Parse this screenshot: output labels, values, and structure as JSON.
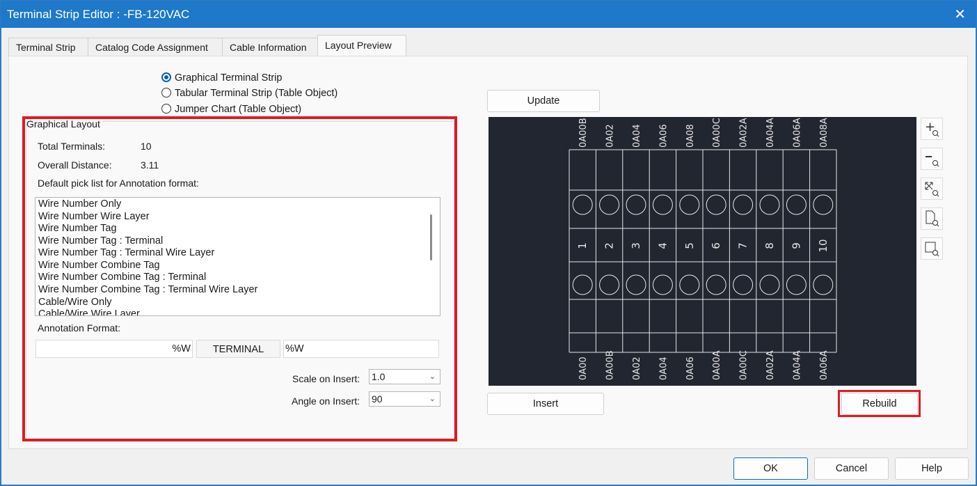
{
  "window": {
    "title": "Terminal Strip Editor : -FB-120VAC",
    "close_glyph": "✕"
  },
  "tabs": [
    {
      "label": "Terminal Strip"
    },
    {
      "label": "Catalog Code Assignment"
    },
    {
      "label": "Cable Information"
    },
    {
      "label": "Layout Preview"
    }
  ],
  "radios": [
    {
      "label": "Graphical Terminal Strip",
      "selected": true
    },
    {
      "label": "Tabular Terminal Strip (Table Object)",
      "selected": false
    },
    {
      "label": "Jumper Chart (Table Object)",
      "selected": false
    }
  ],
  "graphical_layout": {
    "group_label": "Graphical Layout",
    "total_terminals_label": "Total Terminals:",
    "total_terminals_value": "10",
    "overall_distance_label": "Overall Distance:",
    "overall_distance_value": "3.11",
    "picklist_label": "Default pick list for Annotation format:",
    "picklist_items": [
      "Wire Number Only",
      "Wire Number Wire Layer",
      "Wire Number Tag",
      "Wire Number Tag : Terminal",
      "Wire Number Tag : Terminal Wire Layer",
      "Wire Number Combine Tag",
      "Wire Number Combine Tag : Terminal",
      "Wire Number Combine Tag : Terminal Wire Layer",
      "Cable/Wire Only",
      "Cable/Wire Wire Layer"
    ],
    "annotation_format_label": "Annotation Format:",
    "annotation_left": "%W",
    "annotation_middle": "TERMINAL",
    "annotation_right": "%W",
    "scale_label": "Scale on Insert:",
    "scale_value": "1.0",
    "angle_label": "Angle on Insert:",
    "angle_value": "90"
  },
  "buttons": {
    "update": "Update",
    "insert": "Insert",
    "rebuild": "Rebuild",
    "ok": "OK",
    "cancel": "Cancel",
    "help": "Help"
  },
  "preview": {
    "top_labels": [
      "0A00B",
      "0A02",
      "0A04",
      "0A06",
      "0A08",
      "0A00C",
      "0A02A",
      "0A04A",
      "0A06A",
      "0A08A"
    ],
    "terminal_numbers": [
      "1",
      "2",
      "3",
      "4",
      "5",
      "6",
      "7",
      "8",
      "9",
      "10"
    ],
    "bottom_labels": [
      "0A00",
      "0A00B",
      "0A02",
      "0A04",
      "0A06",
      "0A00A",
      "0A00C",
      "0A02A",
      "0A04A",
      "0A06A"
    ]
  },
  "toolbar_icons": [
    "zoom-in-icon",
    "zoom-out-icon",
    "zoom-extents-icon",
    "zoom-page-icon",
    "zoom-window-icon"
  ],
  "colors": {
    "accent": "#1f78c9",
    "highlight": "#e01b24",
    "preview_bg": "#222630",
    "preview_line": "#e6e6e6"
  }
}
